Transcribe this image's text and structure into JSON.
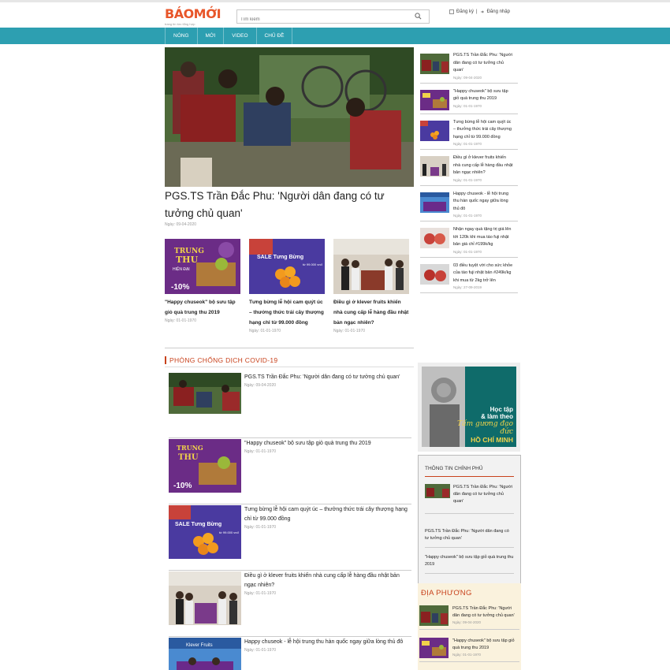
{
  "header": {
    "logo_text": "BÁOMỚI",
    "logo_tagline": "trang tin tức tổng hợp",
    "search_placeholder": "Tìm kiếm",
    "register_label": "Đăng ký",
    "separator": "|",
    "login_label": "Đăng nhập"
  },
  "nav": {
    "items": [
      "NÓNG",
      "MỚI",
      "VIDEO",
      "CHỦ ĐỀ"
    ]
  },
  "hero": {
    "title": "PGS.TS Trần Đắc Phu: 'Người dân đang có tư tưởng chủ quan'",
    "date": "Ngày: 09-04-2020"
  },
  "trio": [
    {
      "title": "\"Happy chuseok\" bộ sưu tập giỏ quà trung thu 2019",
      "date": "Ngày: 01-01-1970",
      "thumb": "midautumn-basket"
    },
    {
      "title": "Tưng bừng lễ hội cam quýt úc – thưởng thức trái cây thượng hạng chỉ từ 99.000 đồng",
      "date": "Ngày: 01-01-1970",
      "thumb": "orange-sale"
    },
    {
      "title": "Điều gì ở klever fruits khiến nhà cung cấp lễ hàng đầu nhật bản ngạc nhiên?",
      "date": "Ngày: 01-01-1970",
      "thumb": "event-group"
    }
  ],
  "covid_section": {
    "heading": "PHÒNG CHỐNG DỊCH COVID-19",
    "items": [
      {
        "title": "PGS.TS Trần Đắc Phu: 'Người dân đang có tư tưởng chủ quan'",
        "date": "Ngày: 09-04-2020",
        "thumb": "street-scene"
      },
      {
        "title": "\"Happy chuseok\" bộ sưu tập giỏ quà trung thu 2019",
        "date": "Ngày: 01-01-1970",
        "thumb": "midautumn-basket"
      },
      {
        "title": "Tưng bừng lễ hội cam quýt úc – thưởng thức trái cây thượng hạng chỉ từ 99.000 đồng",
        "date": "Ngày: 01-01-1970",
        "thumb": "orange-sale"
      },
      {
        "title": "Điều gì ở klever fruits khiến nhà cung cấp lễ hàng đầu nhật bản ngạc nhiên?",
        "date": "Ngày: 01-01-1970",
        "thumb": "event-group"
      },
      {
        "title": "Happy chuseok - lễ hội trung thu hàn quốc ngay giữa lòng thủ đô",
        "date": "Ngày: 01-01-1970",
        "thumb": "festival-stage"
      }
    ]
  },
  "right_list": [
    {
      "title": "PGS.TS Trần Đắc Phu: 'Người dân đang có tư tưởng chủ quan'",
      "date": "Ngày: 09-04-2020",
      "thumb": "street-scene"
    },
    {
      "title": "\"Happy chuseok\" bộ sưu tập giỏ quà trung thu 2019",
      "date": "Ngày: 01-01-1970",
      "thumb": "midautumn-basket"
    },
    {
      "title": "Tưng bừng lễ hội cam quýt úc – thưởng thức trái cây thượng hạng chỉ từ 99.000 đồng",
      "date": "Ngày: 01-01-1970",
      "thumb": "orange-sale"
    },
    {
      "title": "Điều gì ở klever fruits khiến nhà cung cấp lễ hàng đầu nhật bản ngạc nhiên?",
      "date": "Ngày: 01-01-1970",
      "thumb": "event-group"
    },
    {
      "title": "Happy chuseok - lễ hội trung thu hàn quốc ngay giữa lòng thủ đô",
      "date": "Ngày: 01-01-1970",
      "thumb": "festival-stage"
    },
    {
      "title": "Nhận ngay quà tặng trị giá lên tới 120k khi mua táo fuji nhật bản giá chỉ #199k/kg",
      "date": "Ngày: 01-01-1970",
      "thumb": "apples"
    },
    {
      "title": "03 điều tuyệt vời cho sức khỏe của táo fuji nhật bản #249k/kg khi mua từ 2kg trở lên",
      "date": "Ngày: 27-09-2019",
      "thumb": "apples-red"
    }
  ],
  "banner": {
    "line1": "Học tập",
    "line2": "& làm theo",
    "line3": "Tấm gương đạo đức",
    "line4": "HỒ CHÍ MINH"
  },
  "gov_box": {
    "heading": "THÔNG TIN CHÍNH PHỦ",
    "first_title": "PGS.TS Trần Đắc Phu: 'Người dân đang có tư tưởng chủ quan'",
    "lines": [
      "PGS.TS Trần Đắc Phu: 'Người dân đang có tư tưởng chủ quan'",
      "\"Happy chuseok\" bộ sưu tập giỏ quà trung thu 2019"
    ]
  },
  "local_box": {
    "heading": "ĐỊA PHƯƠNG",
    "items": [
      {
        "title": "PGS.TS Trần Đắc Phu: 'Người dân đang có tư tưởng chủ quan'",
        "date": "Ngày: 09-04-2020",
        "thumb": "street-scene"
      },
      {
        "title": "\"Happy chuseok\" bộ sưu tập giỏ quà trung thu 2019",
        "date": "Ngày: 01-01-1970",
        "thumb": "midautumn-basket"
      }
    ]
  },
  "thumb_texts": {
    "mid_trung": "TRUNG",
    "mid_thu": "THU",
    "mid_hien": "HIỆN ĐẠI",
    "mid_sang": "SANG...",
    "mid_discount": "-10%",
    "sale_text": "SALE Tưng Bừng",
    "sale_price": "từ 99.000 vnđ",
    "brand": "Klever Fruits"
  },
  "colors": {
    "brand": "#e8562a",
    "nav": "#2d9fb1",
    "section": "#c8421c",
    "purple": "#6b2c86"
  }
}
